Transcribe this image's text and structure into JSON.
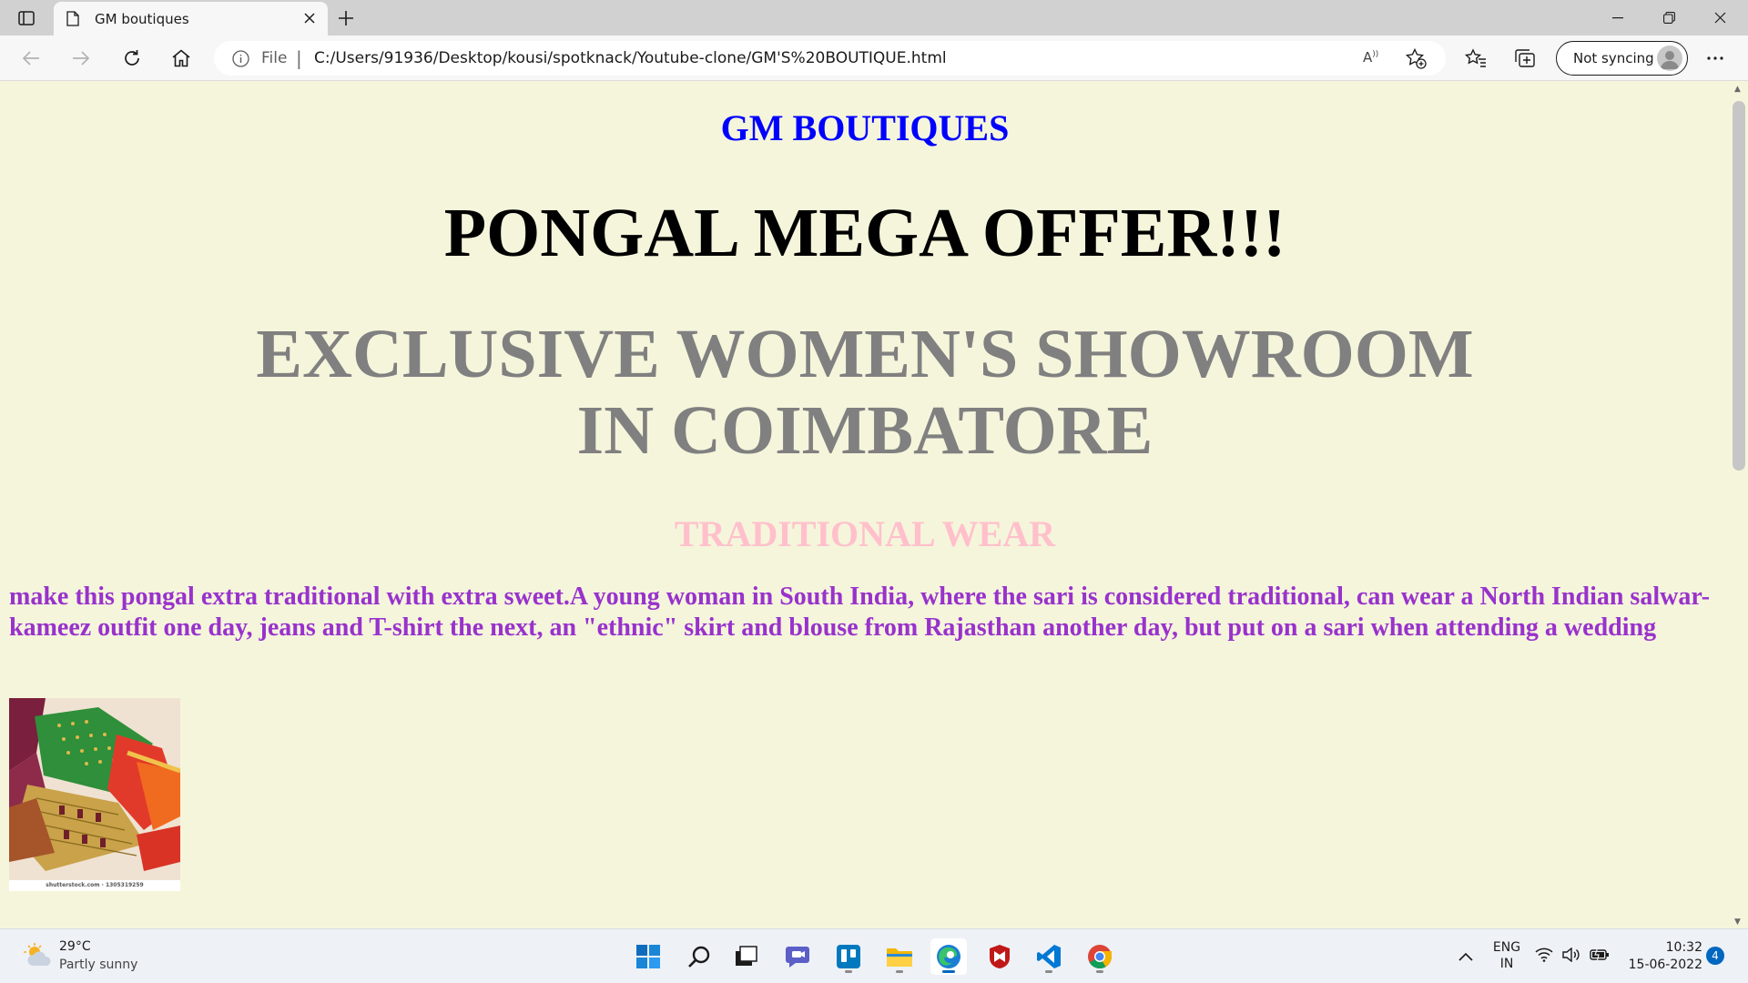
{
  "browser": {
    "tab_title": "GM boutiques",
    "address_scheme": "File",
    "address_url": "C:/Users/91936/Desktop/kousi/spotknack/Youtube-clone/GM'S%20BOUTIQUE.html",
    "sync_label": "Not syncing"
  },
  "page": {
    "brand": "GM BOUTIQUES",
    "offer": "PONGAL MEGA OFFER!!!",
    "showroom": "EXCLUSIVE WOMEN'S SHOWROOM IN COIMBATORE",
    "section": "TRADITIONAL WEAR",
    "paragraph": "make this pongal extra traditional with extra sweet.A young woman in South India, where the sari is considered traditional, can wear a North Indian salwar-kameez outfit one day, jeans and T-shirt the next, an \"ethnic\" skirt and blouse from Rajasthan another day, but put on a sari when attending a wedding",
    "image_credit": "shutterstock.com · 1305319259"
  },
  "colors": {
    "page_bg": "#f5f5dc",
    "brand": "#0000ff",
    "offer": "#000000",
    "showroom": "#808080",
    "section": "#ffc0cb",
    "paragraph": "#9932cc"
  },
  "taskbar": {
    "weather_temp": "29°C",
    "weather_desc": "Partly sunny",
    "lang_1": "ENG",
    "lang_2": "IN",
    "time": "10:32",
    "date": "15-06-2022",
    "notification_count": "4",
    "apps": [
      "start-icon",
      "search-icon",
      "task-view-icon",
      "chat-icon",
      "trello-icon",
      "file-explorer-icon",
      "edge-icon",
      "mcafee-icon",
      "vscode-icon",
      "chrome-icon"
    ]
  }
}
